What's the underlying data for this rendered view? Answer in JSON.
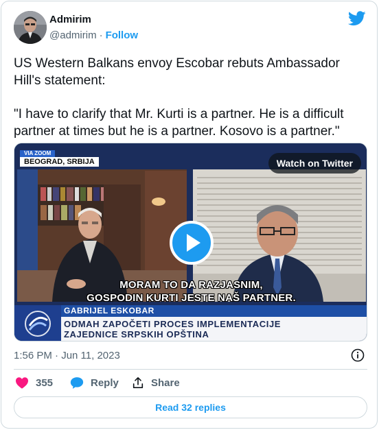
{
  "author": {
    "name": "Admirim",
    "handle": "@admirim",
    "separator": "·",
    "follow_label": "Follow"
  },
  "tweet": {
    "paragraph1": "US Western Balkans envoy Escobar rebuts Ambassador Hill's statement:",
    "paragraph2": "\"I have to clarify that Mr. Kurti is a partner. He is a difficult partner at times but he is a partner. Kosovo is a partner.\""
  },
  "media": {
    "via_label": "VIA ZOOM",
    "location": "BEOGRAD, SRBIJA",
    "watch_label": "Watch on Twitter",
    "subtitle_line1": "MORAM TO DA RAZJASNIM,",
    "subtitle_line2": "GOSPODIN KURTI JESTE NAŠ PARTNER.",
    "lower_third_name": "GABRIJEL ESKOBAR",
    "lower_third_line1": "ODMAH ZAPOČETI PROCES IMPLEMENTACIJE",
    "lower_third_line2": "ZAJEDNICE SRPSKIH OPŠTINA"
  },
  "meta": {
    "timestamp": "1:56 PM · Jun 11, 2023"
  },
  "actions": {
    "likes_count": "355",
    "reply_label": "Reply",
    "share_label": "Share",
    "read_replies_label": "Read 32 replies"
  },
  "colors": {
    "accent": "#1d9bf0",
    "like": "#f91880",
    "secondary_text": "#536471",
    "border": "#cfd9de"
  },
  "icons": [
    "twitter-bird-icon",
    "play-icon",
    "info-icon",
    "heart-icon",
    "reply-bubble-icon",
    "share-icon"
  ]
}
